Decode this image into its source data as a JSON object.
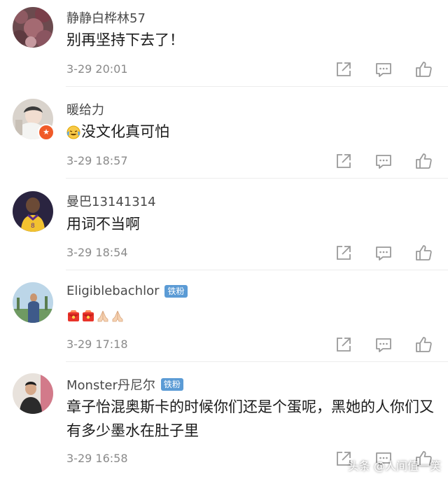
{
  "comments": [
    {
      "username": "静静白桦林57",
      "text": "别再坚持下去了！",
      "time": "3-29 20:01"
    },
    {
      "username": "暖给力",
      "text": "没文化真可怕",
      "emoji_prefix": "crying-laughing-face",
      "time": "3-29 18:57"
    },
    {
      "username": "曼巴13141314",
      "text": "用词不当啊",
      "time": "3-29 18:54"
    },
    {
      "username": "Eligiblebachlor",
      "badge": "铁粉",
      "emojis": [
        "red-envelope",
        "red-envelope",
        "folded-hands",
        "folded-hands"
      ],
      "time": "3-29 17:18"
    },
    {
      "username": "Monster丹尼尔",
      "badge": "铁粉",
      "text": "章子怡混奥斯卡的时候你们还是个蛋呢，黑她的人你们又有多少墨水在肚子里",
      "time": "3-29 16:58"
    }
  ],
  "watermark": "头条 @人间值一笑",
  "colors": {
    "username": "#4a4a4a",
    "time": "#8a8a8a",
    "badge": "#5b9bd5",
    "icon": "#9a9a9a"
  },
  "icons": [
    "share-icon",
    "comment-icon",
    "like-icon"
  ]
}
